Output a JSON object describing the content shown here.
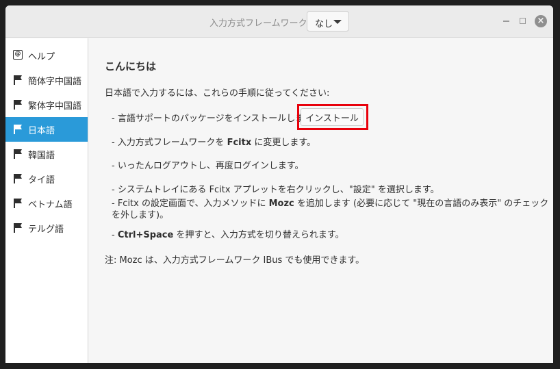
{
  "titlebar": {
    "label": "入力方式フレームワーク:",
    "selected": "なし"
  },
  "sidebar": {
    "items": [
      {
        "label": "ヘルプ",
        "icon": "help-icon",
        "active": false
      },
      {
        "label": "簡体字中国語",
        "icon": "flag-icon",
        "active": false
      },
      {
        "label": "繁体字中国語",
        "icon": "flag-icon",
        "active": false
      },
      {
        "label": "日本語",
        "icon": "flag-icon",
        "active": true
      },
      {
        "label": "韓国語",
        "icon": "flag-icon",
        "active": false
      },
      {
        "label": "タイ語",
        "icon": "flag-icon",
        "active": false
      },
      {
        "label": "ベトナム語",
        "icon": "flag-icon",
        "active": false
      },
      {
        "label": "テルグ語",
        "icon": "flag-icon",
        "active": false
      }
    ]
  },
  "content": {
    "heading": "こんにちは",
    "intro": "日本語で入力するには、これらの手順に従ってください:",
    "step1": "- 言語サポートのパッケージをインストールします:",
    "install_label": "インストール",
    "step2_pre": "- 入力方式フレームワークを ",
    "step2_bold": "Fcitx",
    "step2_post": " に変更します。",
    "step3": "- いったんログアウトし、再度ログインします。",
    "step4": "- システムトレイにある Fcitx アプレットを右クリックし、\"設定\" を選択します。",
    "step5_pre": "- Fcitx の設定画面で、入力メソッドに ",
    "step5_bold": "Mozc",
    "step5_post": " を追加します (必要に応じて \"現在の言語のみ表示\" のチェックを外します)。",
    "step6_pre": "- ",
    "step6_bold": "Ctrl+Space",
    "step6_post": " を押すと、入力方式を切り替えられます。",
    "note": "注: Mozc は、入力方式フレームワーク IBus でも使用できます。"
  },
  "colors": {
    "accent": "#2a9ad9",
    "highlight": "#e8000b"
  }
}
